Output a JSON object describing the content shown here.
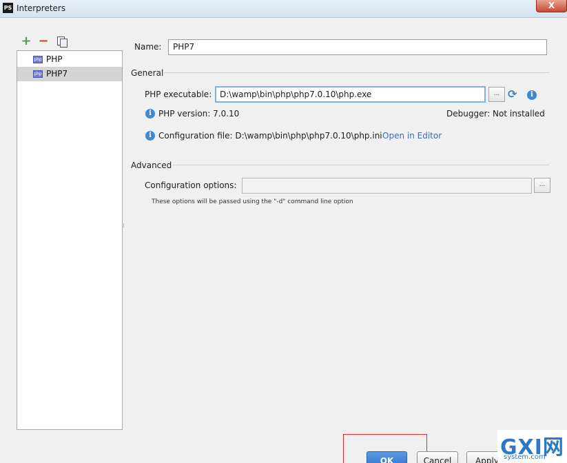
{
  "window": {
    "title": "Interpreters",
    "app_logo": "PS",
    "close_glyph": "X"
  },
  "toolbar": {
    "add": "+",
    "remove": "−"
  },
  "interpreters": [
    {
      "label": "PHP",
      "selected": false,
      "icon_text": "php"
    },
    {
      "label": "PHP7",
      "selected": true,
      "icon_text": "php"
    }
  ],
  "form": {
    "name_label": "Name:",
    "name_value": "PHP7",
    "general_title": "General",
    "exe_label": "PHP executable:",
    "exe_value": "D:\\wamp\\bin\\php\\php7.0.10\\php.exe",
    "browse_glyph": "...",
    "version_text": "PHP version: 7.0.10",
    "debugger_text": "Debugger: Not installed",
    "config_file_text": "Configuration file: D:\\wamp\\bin\\php\\php7.0.10\\php.ini",
    "open_in_editor": "Open in Editor",
    "advanced_title": "Advanced",
    "config_opts_label": "Configuration options:",
    "config_opts_value": "",
    "hint": "These options will be passed using the \"-d\" command line option"
  },
  "buttons": {
    "ok": "OK",
    "cancel": "Cancel",
    "apply": "Apply"
  },
  "watermark": {
    "big": "GXI网",
    "small": "system.com"
  },
  "colors": {
    "accent": "#3d8ad0",
    "ok_button": "#2e6fce",
    "add_icon": "#4aa34a",
    "remove_icon": "#d03a3a",
    "highlight": "#e62a2a"
  }
}
